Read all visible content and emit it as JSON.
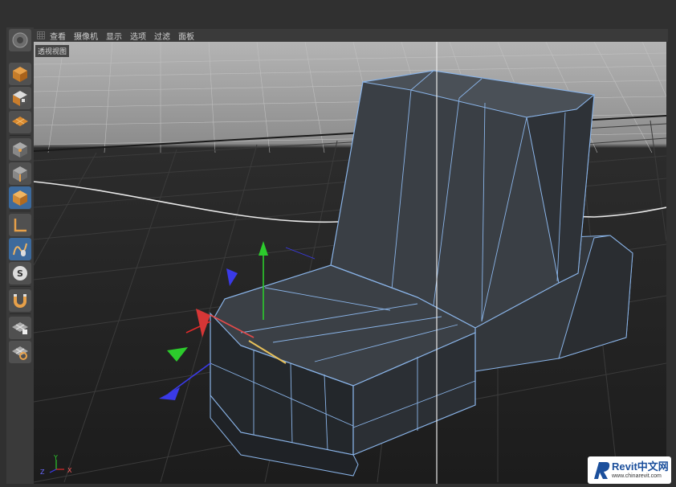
{
  "menu": {
    "items": [
      "查看",
      "摄像机",
      "显示",
      "选项",
      "过滤",
      "面板"
    ]
  },
  "viewport": {
    "label": "透视视图"
  },
  "axes": {
    "y": "Y",
    "z": "Z",
    "x": "X"
  },
  "watermark": {
    "brand": "Revit中文网",
    "url": "www.chinarevit.com"
  },
  "tools": [
    {
      "name": "cube-icon"
    },
    {
      "name": "checker-cube-icon"
    },
    {
      "name": "checker-plane-icon"
    },
    {
      "name": "points-mode-icon"
    },
    {
      "name": "edges-mode-icon"
    },
    {
      "name": "polygons-mode-icon"
    },
    {
      "name": "axis-mode-icon"
    },
    {
      "name": "tweak-mode-icon"
    },
    {
      "name": "snap-icon"
    },
    {
      "name": "magnet-icon"
    },
    {
      "name": "workplane-lock-icon"
    },
    {
      "name": "workplane-icon"
    }
  ],
  "colors": {
    "selection": "#8ab4e8",
    "active_tool": "#3d6a9c",
    "axis_x": "#d33",
    "axis_y": "#2c2",
    "axis_z": "#33d"
  }
}
